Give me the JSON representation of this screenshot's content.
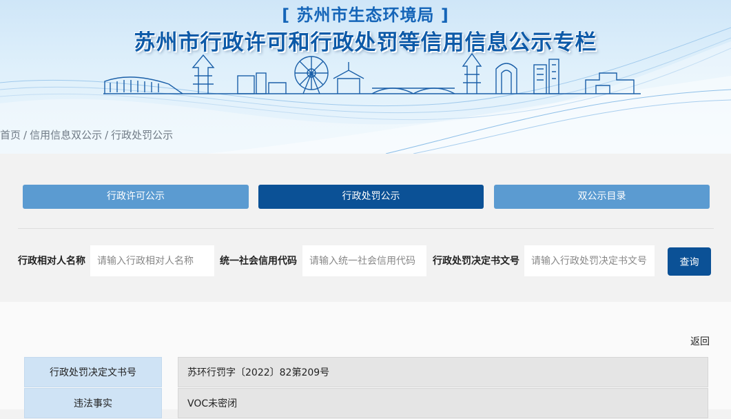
{
  "banner": {
    "agency": "[ 苏州市生态环境局 ]",
    "title": "苏州市行政许可和行政处罚等信用信息公示专栏"
  },
  "breadcrumb": {
    "items": [
      "首页",
      "信用信息双公示",
      "行政处罚公示"
    ],
    "separator": "/"
  },
  "tabs": [
    {
      "label": "行政许可公示",
      "active": false
    },
    {
      "label": "行政处罚公示",
      "active": true
    },
    {
      "label": "双公示目录",
      "active": false
    }
  ],
  "search": {
    "fields": [
      {
        "label": "行政相对人名称",
        "placeholder": "请输入行政相对人名称",
        "value": ""
      },
      {
        "label": "统一社会信用代码",
        "placeholder": "请输入统一社会信用代码",
        "value": ""
      },
      {
        "label": "行政处罚决定书文号",
        "placeholder": "请输入行政处罚决定书文号",
        "value": ""
      }
    ],
    "button_label": "查询"
  },
  "detail": {
    "back_label": "返回",
    "rows": [
      {
        "key": "行政处罚决定文书号",
        "value": "苏环行罚字〔2022〕82第209号"
      },
      {
        "key": "违法事实",
        "value": "VOC未密闭"
      }
    ]
  },
  "colors": {
    "active_tab": "#0b5196",
    "inactive_tab": "#5b9bd1",
    "title_blue": "#0d5aa8",
    "key_cell": "#cfe3f5",
    "value_cell": "#e5e5e5"
  }
}
